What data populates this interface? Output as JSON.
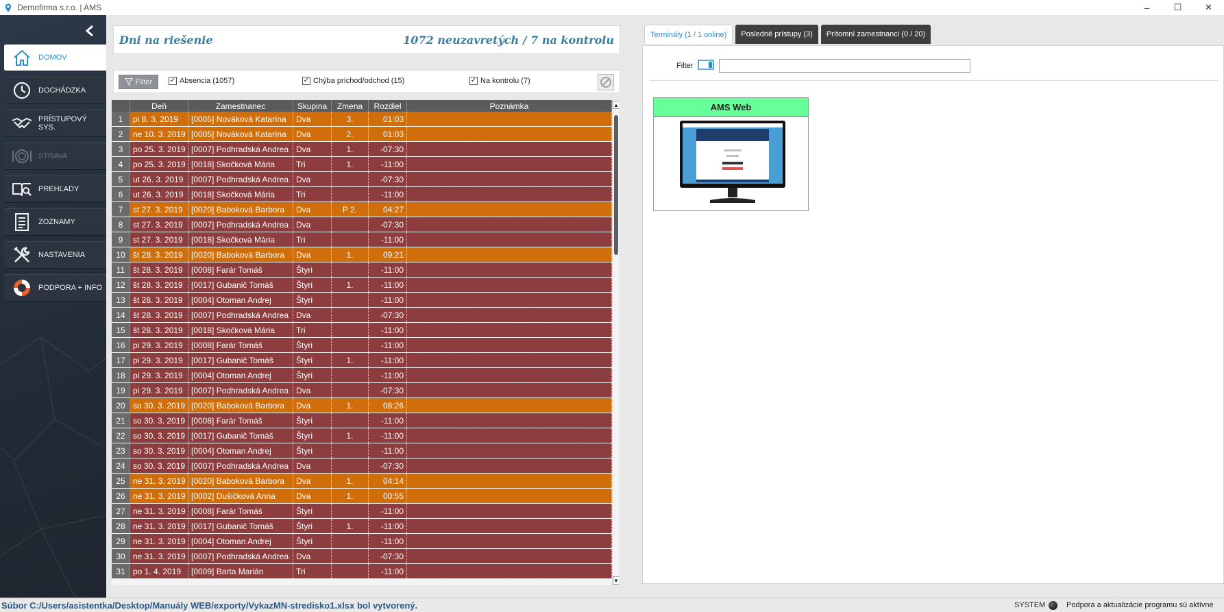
{
  "window": {
    "title": "Demofirma s.r.o. | AMS",
    "controls": [
      "–",
      "☐",
      "✕"
    ]
  },
  "sidebar": {
    "items": [
      {
        "label": "DOMOV",
        "icon": "home-icon",
        "state": "active"
      },
      {
        "label": "DOCHÁDZKA",
        "icon": "clock-icon",
        "state": "normal"
      },
      {
        "label": "PRÍSTUPOVÝ SYS.",
        "icon": "handshake-icon",
        "state": "normal"
      },
      {
        "label": "STRAVA",
        "icon": "plate-icon",
        "state": "disabled"
      },
      {
        "label": "PREHĽADY",
        "icon": "book-search-icon",
        "state": "normal"
      },
      {
        "label": "ZOZNAMY",
        "icon": "list-icon",
        "state": "normal"
      },
      {
        "label": "NASTAVENIA",
        "icon": "tools-icon",
        "state": "normal"
      },
      {
        "label": "PODPORA + INFO",
        "icon": "lifebuoy-icon",
        "state": "normal"
      }
    ]
  },
  "header": {
    "title": "Dni na riešenie",
    "summary": "1072 neuzavretých / 7 na kontrolu"
  },
  "filters": {
    "button_label": "Filter",
    "checks": [
      {
        "label": "Absencia (1057)",
        "checked": true
      },
      {
        "label": "Chýba príchod/odchod (15)",
        "checked": true
      },
      {
        "label": "Na kontrolu (7)",
        "checked": true
      }
    ]
  },
  "table": {
    "columns": [
      "",
      "Deň",
      "Zamestnanec",
      "Skupina",
      "Zmena",
      "Rozdiel",
      "Poznámka"
    ],
    "rows": [
      [
        "1",
        "pi 8. 3. 2019",
        "[0005] Nováková Katarína",
        "Dva",
        "3.",
        "01:03",
        "",
        "orange"
      ],
      [
        "2",
        "ne 10. 3. 2019",
        "[0005] Nováková Katarína",
        "Dva",
        "2.",
        "01:03",
        "",
        "orange"
      ],
      [
        "3",
        "po 25. 3. 2019",
        "[0007] Podhradská Andrea",
        "Dva",
        "1.",
        "-07:30",
        "",
        "red"
      ],
      [
        "4",
        "po 25. 3. 2019",
        "[0018] Skočková Mária",
        "Tri",
        "1.",
        "-11:00",
        "",
        "red"
      ],
      [
        "5",
        "ut 26. 3. 2019",
        "[0007] Podhradská Andrea",
        "Dva",
        "",
        "-07:30",
        "",
        "red"
      ],
      [
        "6",
        "ut 26. 3. 2019",
        "[0018] Skočková Mária",
        "Tri",
        "",
        "-11:00",
        "",
        "red"
      ],
      [
        "7",
        "st 27. 3. 2019",
        "[0020] Baboková Barbora",
        "Dva",
        "P 2.",
        "04:27",
        "",
        "orange"
      ],
      [
        "8",
        "st 27. 3. 2019",
        "[0007] Podhradská Andrea",
        "Dva",
        "",
        "-07:30",
        "",
        "red"
      ],
      [
        "9",
        "st 27. 3. 2019",
        "[0018] Skočková Mária",
        "Tri",
        "",
        "-11:00",
        "",
        "red"
      ],
      [
        "10",
        "št 28. 3. 2019",
        "[0020] Baboková Barbora",
        "Dva",
        "1.",
        "09:21",
        "",
        "orange"
      ],
      [
        "11",
        "št 28. 3. 2019",
        "[0008] Farár Tomáš",
        "Štyri",
        "",
        "-11:00",
        "",
        "red"
      ],
      [
        "12",
        "št 28. 3. 2019",
        "[0017] Gubanič Tomáš",
        "Štyri",
        "1.",
        "-11:00",
        "",
        "red"
      ],
      [
        "13",
        "št 28. 3. 2019",
        "[0004] Otoman Andrej",
        "Štyri",
        "",
        "-11:00",
        "",
        "red"
      ],
      [
        "14",
        "št 28. 3. 2019",
        "[0007] Podhradská Andrea",
        "Dva",
        "",
        "-07:30",
        "",
        "red"
      ],
      [
        "15",
        "št 28. 3. 2019",
        "[0018] Skočková Mária",
        "Tri",
        "",
        "-11:00",
        "",
        "red"
      ],
      [
        "16",
        "pi 29. 3. 2019",
        "[0008] Farár Tomáš",
        "Štyri",
        "",
        "-11:00",
        "",
        "red"
      ],
      [
        "17",
        "pi 29. 3. 2019",
        "[0017] Gubanič Tomáš",
        "Štyri",
        "1.",
        "-11:00",
        "",
        "red"
      ],
      [
        "18",
        "pi 29. 3. 2019",
        "[0004] Otoman Andrej",
        "Štyri",
        "",
        "-11:00",
        "",
        "red"
      ],
      [
        "19",
        "pi 29. 3. 2019",
        "[0007] Podhradská Andrea",
        "Dva",
        "",
        "-07:30",
        "",
        "red"
      ],
      [
        "20",
        "so 30. 3. 2019",
        "[0020] Baboková Barbora",
        "Dva",
        "1.",
        "08:26",
        "",
        "orange"
      ],
      [
        "21",
        "so 30. 3. 2019",
        "[0008] Farár Tomáš",
        "Štyri",
        "",
        "-11:00",
        "",
        "red"
      ],
      [
        "22",
        "so 30. 3. 2019",
        "[0017] Gubanič Tomáš",
        "Štyri",
        "1.",
        "-11:00",
        "",
        "red"
      ],
      [
        "23",
        "so 30. 3. 2019",
        "[0004] Otoman Andrej",
        "Štyri",
        "",
        "-11:00",
        "",
        "red"
      ],
      [
        "24",
        "so 30. 3. 2019",
        "[0007] Podhradská Andrea",
        "Dva",
        "",
        "-07:30",
        "",
        "red"
      ],
      [
        "25",
        "ne 31. 3. 2019",
        "[0020] Baboková Barbora",
        "Dva",
        "1.",
        "04:14",
        "",
        "orange"
      ],
      [
        "26",
        "ne 31. 3. 2019",
        "[0002] Dušičková Anna",
        "Dva",
        "1.",
        "00:55",
        "",
        "orange"
      ],
      [
        "27",
        "ne 31. 3. 2019",
        "[0008] Farár Tomáš",
        "Štyri",
        "",
        "-11:00",
        "",
        "red"
      ],
      [
        "28",
        "ne 31. 3. 2019",
        "[0017] Gubanič Tomáš",
        "Štyri",
        "1.",
        "-11:00",
        "",
        "red"
      ],
      [
        "29",
        "ne 31. 3. 2019",
        "[0004] Otoman Andrej",
        "Štyri",
        "",
        "-11:00",
        "",
        "red"
      ],
      [
        "30",
        "ne 31. 3. 2019",
        "[0007] Podhradská Andrea",
        "Dva",
        "",
        "-07:30",
        "",
        "red"
      ],
      [
        "31",
        "po 1. 4. 2019",
        "[0009] Barta Marián",
        "Tri",
        "",
        "-11:00",
        "",
        "red"
      ]
    ]
  },
  "right_panel": {
    "tabs": [
      {
        "label": "Terminály (1 / 1 online)",
        "active": true
      },
      {
        "label": "Posledné prístupy (3)",
        "active": false
      },
      {
        "label": "Prítomní zamestnanci (0 / 20)",
        "active": false
      }
    ],
    "filter_label": "Filter",
    "filter_value": "",
    "terminal": {
      "title": "AMS Web"
    }
  },
  "statusbar": {
    "message": "Súbor C:/Users/asistentka/Desktop/Manuály WEB/exporty/VykazMN-stredisko1.xlsx bol vytvorený.",
    "user": "SYSTEM",
    "info": "Podpora a aktualizácie programu sú aktívne"
  },
  "colors": {
    "accent": "#2b8ed2",
    "row_red": "#8e3d3f",
    "row_orange": "#d06e0c",
    "terminal_header": "#66ff99"
  }
}
